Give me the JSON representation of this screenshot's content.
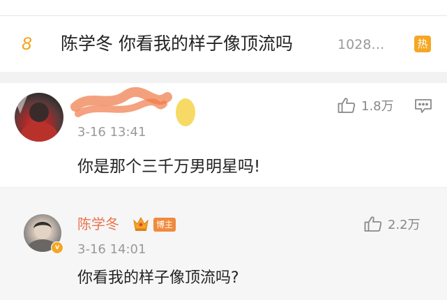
{
  "hot_search": {
    "rank": "8",
    "title": "陈学冬 你看我的样子像顶流吗",
    "count": "1028…",
    "badge": "热",
    "rank_color": "#f5a623",
    "badge_color": "#f5a623"
  },
  "comment": {
    "avatar_icon": "user-avatar-obscured",
    "time": "3-16 13:41",
    "text": "你是那个三千万男明星吗!",
    "likes": "1.8万",
    "like_icon": "thumbs-up-icon",
    "reply_icon": "comment-icon"
  },
  "reply": {
    "avatar_icon": "user-avatar",
    "verified_icon": "verified-badge-icon",
    "name": "陈学冬",
    "name_color": "#eb7350",
    "crown_icon": "crown-icon",
    "author_badge": "博主",
    "time": "3-16 14:01",
    "text": "你看我的样子像顶流吗?",
    "likes": "2.2万",
    "like_icon": "thumbs-up-icon"
  }
}
